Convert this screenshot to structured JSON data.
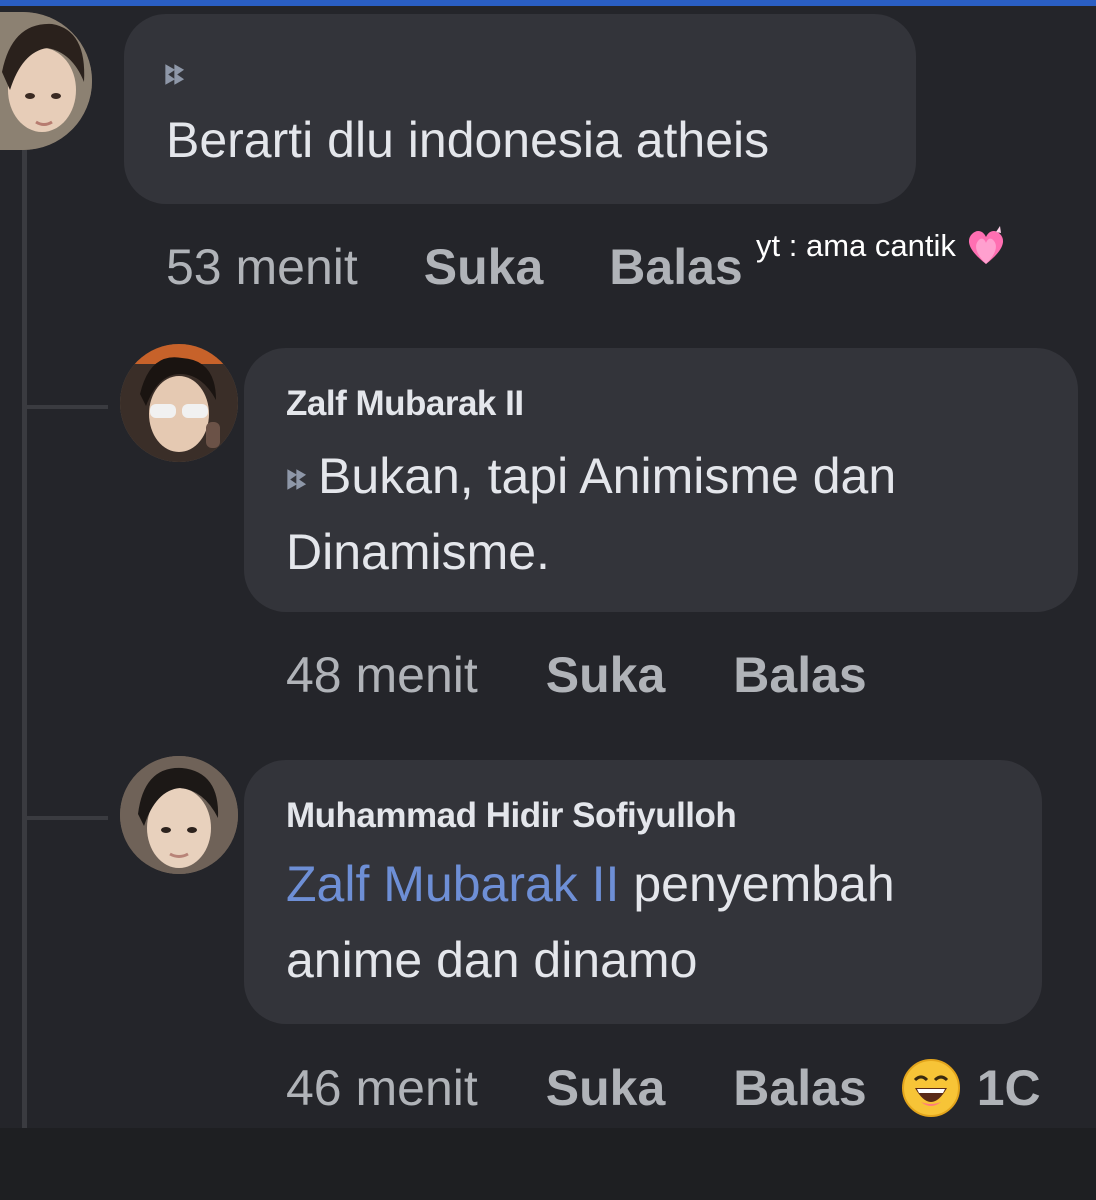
{
  "watermark": {
    "text": "yt : ama cantik",
    "icon": "heart-emoji-icon"
  },
  "comments": [
    {
      "author": "",
      "prefix_glyph": "ꔪꔪ",
      "text": "Berarti dlu indonesia atheis",
      "time": "53 menit",
      "like_label": "Suka",
      "reply_label": "Balas"
    },
    {
      "author": "Zalf Mubarak II",
      "prefix_glyph": "ꔪꔪ",
      "text_line1": "Bukan, tapi Animisme dan",
      "text_line2": "Dinamisme.",
      "time": "48 menit",
      "like_label": "Suka",
      "reply_label": "Balas"
    },
    {
      "author": "Muhammad Hidir Sofiyulloh",
      "mention": "Zalf Mubarak II",
      "text_line1_rest": " penyembah",
      "text_line2": "anime dan dinamo",
      "time": "46 menit",
      "like_label": "Suka",
      "reply_label": "Balas",
      "reaction_icon": "laughing-emoji-icon",
      "reaction_count": "1C"
    }
  ],
  "colors": {
    "background": "#24252a",
    "bubble": "#33343a",
    "text": "#e4e6eb",
    "meta": "#b0b3b8",
    "mention": "#6e8fd6",
    "accent_bar": "#2a5fc4"
  }
}
